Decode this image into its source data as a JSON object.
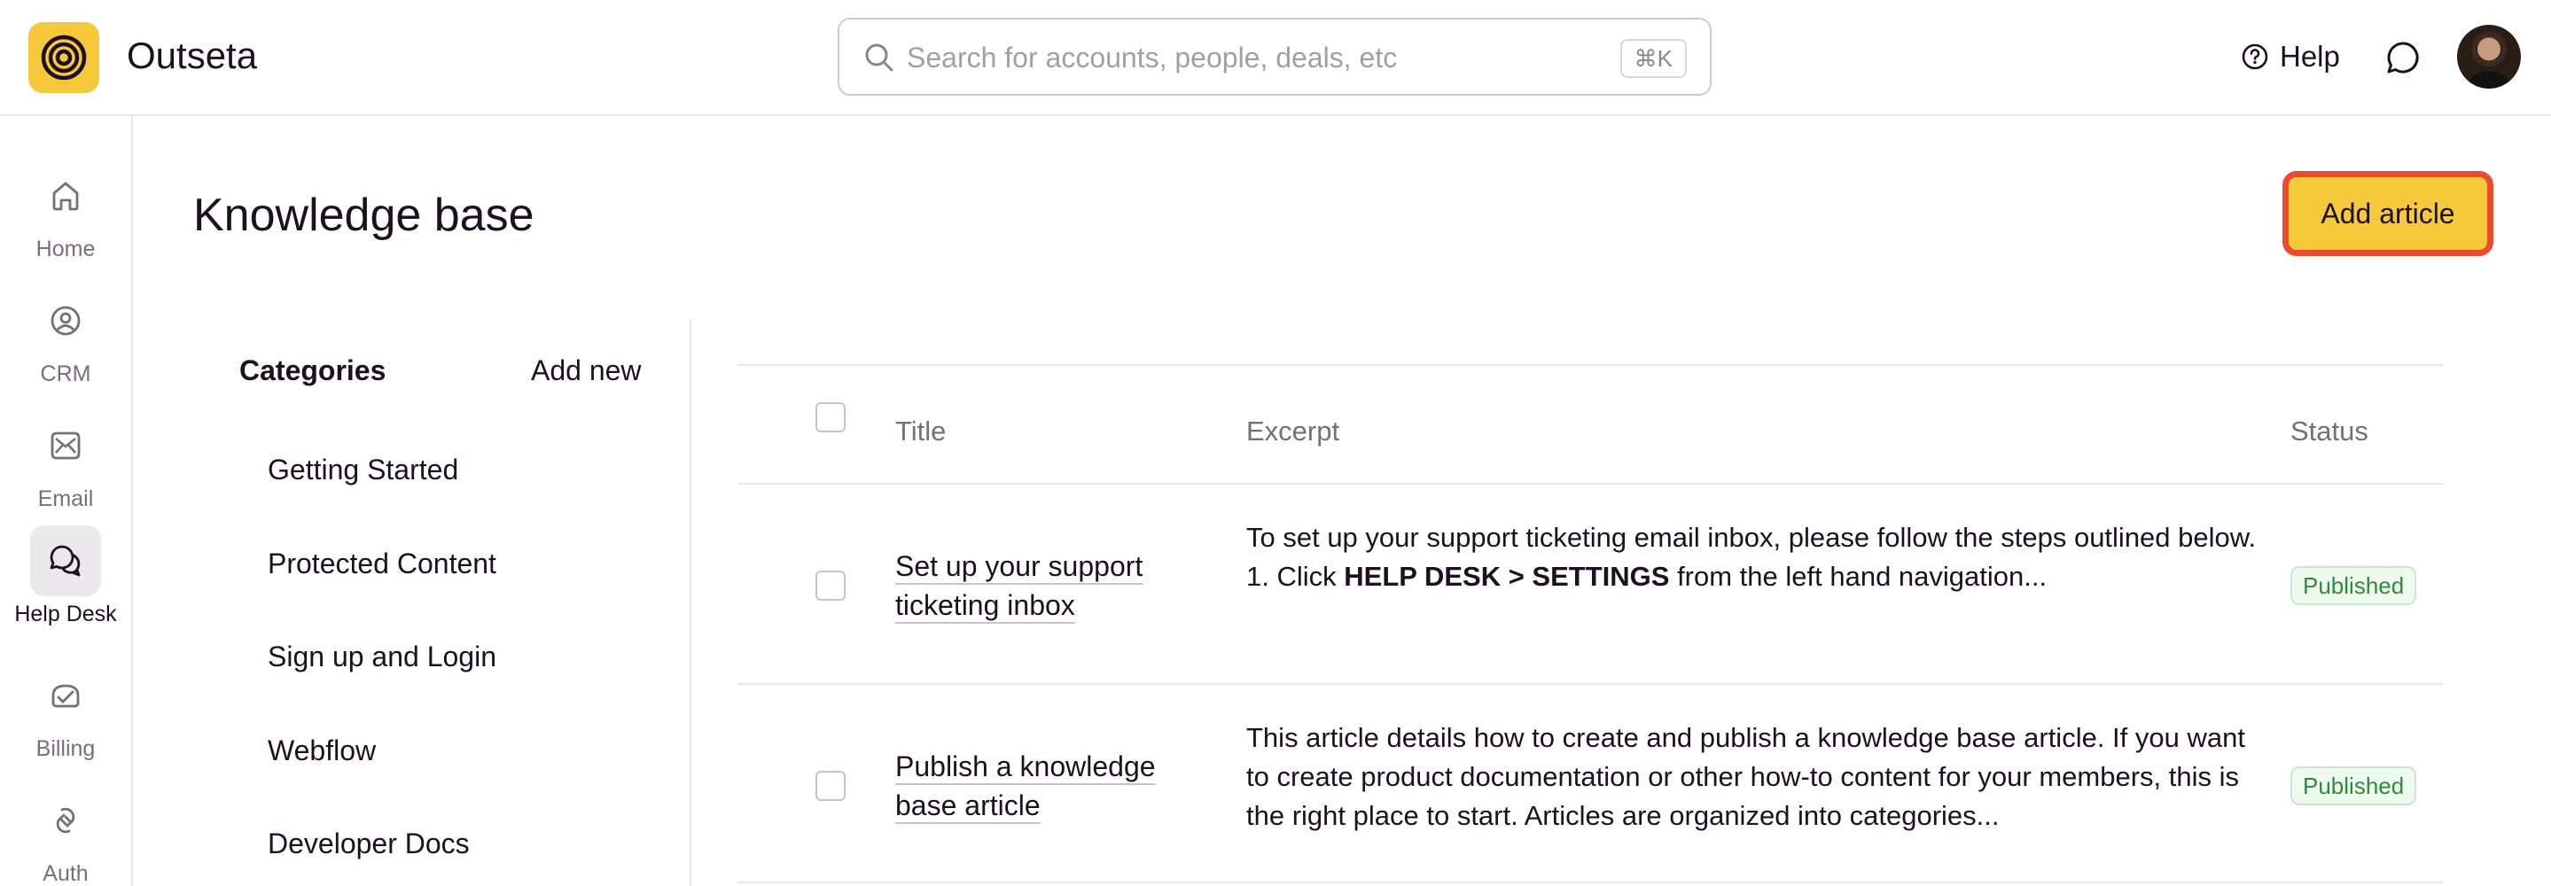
{
  "app": {
    "name": "Outseta"
  },
  "search": {
    "placeholder": "Search for accounts, people, deals, etc",
    "shortcut": "⌘K"
  },
  "header": {
    "help_label": "Help"
  },
  "sidebar": {
    "items": [
      {
        "label": "Home",
        "icon": "home-icon"
      },
      {
        "label": "CRM",
        "icon": "crm-icon"
      },
      {
        "label": "Email",
        "icon": "email-icon"
      },
      {
        "label": "Help Desk",
        "icon": "help-desk-icon",
        "active": true
      },
      {
        "label": "Billing",
        "icon": "billing-icon"
      },
      {
        "label": "Auth",
        "icon": "auth-icon"
      }
    ]
  },
  "page": {
    "title": "Knowledge base",
    "add_article_label": "Add article"
  },
  "categories": {
    "title": "Categories",
    "add_new_label": "Add new",
    "items": [
      "Getting Started",
      "Protected Content",
      "Sign up and Login",
      "Webflow",
      "Developer Docs"
    ]
  },
  "table": {
    "headers": {
      "title": "Title",
      "excerpt": "Excerpt",
      "status": "Status"
    },
    "rows": [
      {
        "title": "Set up your support ticketing inbox",
        "excerpt_line1": "To set up your support ticketing email inbox, please follow the steps outlined below.",
        "excerpt_line2_prefix": "1. Click ",
        "excerpt_line2_bold": "HELP DESK > SETTINGS",
        "excerpt_line2_suffix": " from the left hand navigation...",
        "status": "Published"
      },
      {
        "title": "Publish a knowledge base article",
        "excerpt": "This article details how to create and publish a knowledge base article. If you want to create product documentation or other how-to content for your members, this is the right place to start. Articles are organized into categories...",
        "status": "Published"
      }
    ]
  },
  "colors": {
    "brand": "#f6c93c",
    "highlight": "#ea4a2d",
    "published": "#2e8a3d"
  }
}
